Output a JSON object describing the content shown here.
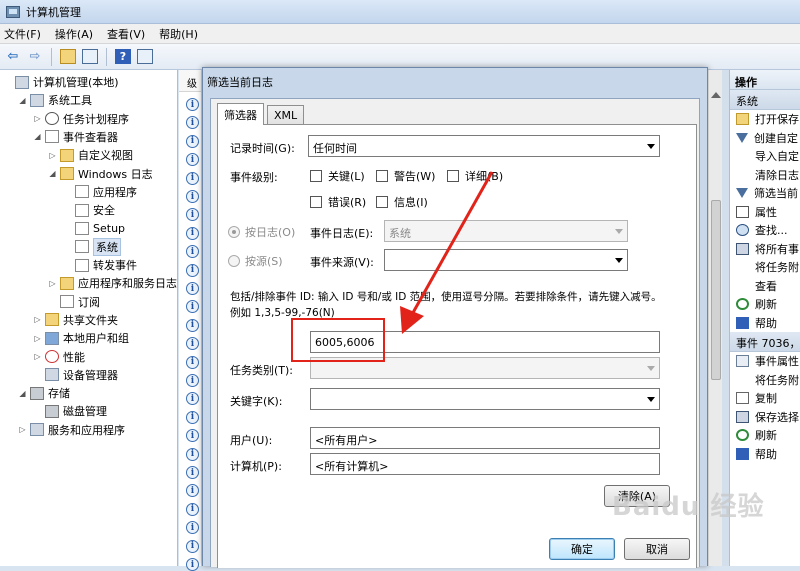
{
  "window": {
    "title": "计算机管理"
  },
  "menu": {
    "items": [
      "文件(F)",
      "操作(A)",
      "查看(V)",
      "帮助(H)"
    ]
  },
  "tree": {
    "items": [
      {
        "label": "计算机管理(本地)",
        "indent": 0,
        "toggle": "",
        "icon": "tool"
      },
      {
        "label": "系统工具",
        "indent": 1,
        "toggle": "◢",
        "icon": "tool"
      },
      {
        "label": "任务计划程序",
        "indent": 2,
        "toggle": "▷",
        "icon": "clock"
      },
      {
        "label": "事件查看器",
        "indent": 2,
        "toggle": "◢",
        "icon": "log"
      },
      {
        "label": "自定义视图",
        "indent": 3,
        "toggle": "▷",
        "icon": "folder"
      },
      {
        "label": "Windows 日志",
        "indent": 3,
        "toggle": "◢",
        "icon": "folder"
      },
      {
        "label": "应用程序",
        "indent": 4,
        "toggle": "",
        "icon": "log"
      },
      {
        "label": "安全",
        "indent": 4,
        "toggle": "",
        "icon": "log"
      },
      {
        "label": "Setup",
        "indent": 4,
        "toggle": "",
        "icon": "log"
      },
      {
        "label": "系统",
        "indent": 4,
        "toggle": "",
        "icon": "log",
        "selected": true
      },
      {
        "label": "转发事件",
        "indent": 4,
        "toggle": "",
        "icon": "log"
      },
      {
        "label": "应用程序和服务日志",
        "indent": 3,
        "toggle": "▷",
        "icon": "folder"
      },
      {
        "label": "订阅",
        "indent": 3,
        "toggle": "",
        "icon": "log"
      },
      {
        "label": "共享文件夹",
        "indent": 2,
        "toggle": "▷",
        "icon": "folder"
      },
      {
        "label": "本地用户和组",
        "indent": 2,
        "toggle": "▷",
        "icon": "users"
      },
      {
        "label": "性能",
        "indent": 2,
        "toggle": "▷",
        "icon": "perf"
      },
      {
        "label": "设备管理器",
        "indent": 2,
        "toggle": "",
        "icon": "tool"
      },
      {
        "label": "存储",
        "indent": 1,
        "toggle": "◢",
        "icon": "drive"
      },
      {
        "label": "磁盘管理",
        "indent": 2,
        "toggle": "",
        "icon": "drive"
      },
      {
        "label": "服务和应用程序",
        "indent": 1,
        "toggle": "▷",
        "icon": "tool"
      }
    ]
  },
  "events_panel": {
    "header": "级",
    "row_icon": "i"
  },
  "actions": {
    "header": "操作",
    "section1": "系统",
    "items1": [
      {
        "label": "打开保存",
        "icon": "open"
      },
      {
        "label": "创建自定",
        "icon": "filter"
      },
      {
        "label": "导入自定",
        "icon": "blank"
      },
      {
        "label": "清除日志",
        "icon": "blank"
      },
      {
        "label": "筛选当前",
        "icon": "filter"
      },
      {
        "label": "属性",
        "icon": "prop"
      },
      {
        "label": "查找...",
        "icon": "find"
      },
      {
        "label": "将所有事",
        "icon": "save"
      },
      {
        "label": "将任务附",
        "icon": "blank"
      },
      {
        "label": "查看",
        "icon": "blank"
      },
      {
        "label": "刷新",
        "icon": "refresh"
      },
      {
        "label": "帮助",
        "icon": "help"
      }
    ],
    "section2": "事件 7036，",
    "items2": [
      {
        "label": "事件属性",
        "icon": "props2"
      },
      {
        "label": "将任务附",
        "icon": "clock"
      },
      {
        "label": "复制",
        "icon": "copy"
      },
      {
        "label": "保存选择",
        "icon": "save"
      },
      {
        "label": "刷新",
        "icon": "refresh"
      },
      {
        "label": "帮助",
        "icon": "help"
      }
    ]
  },
  "dialog": {
    "title": "筛选当前日志",
    "tabs": [
      "筛选器",
      "XML"
    ],
    "logged_label": "记录时间(G):",
    "logged_value": "任何时间",
    "level_label": "事件级别:",
    "levels": [
      "关键(L)",
      "警告(W)",
      "详细(B)",
      "错误(R)",
      "信息(I)"
    ],
    "by_log_label": "按日志(O)",
    "by_source_label": "按源(S)",
    "event_logs_label": "事件日志(E):",
    "event_logs_value": "系统",
    "event_sources_label": "事件来源(V):",
    "event_sources_value": "",
    "hint": "包括/排除事件 ID: 输入 ID 号和/或 ID 范围，使用逗号分隔。若要排除条件，请先键入减号。例如 1,3,5-99,-76(N)",
    "event_ids_value": "6005,6006",
    "task_category_label": "任务类别(T):",
    "keywords_label": "关键字(K):",
    "user_label": "用户(U):",
    "user_value": "<所有用户>",
    "computer_label": "计算机(P):",
    "computer_value": "<所有计算机>",
    "clear_button": "清除(A)",
    "ok_button": "确定",
    "cancel_button": "取消"
  },
  "watermark": "Baidu 经验"
}
